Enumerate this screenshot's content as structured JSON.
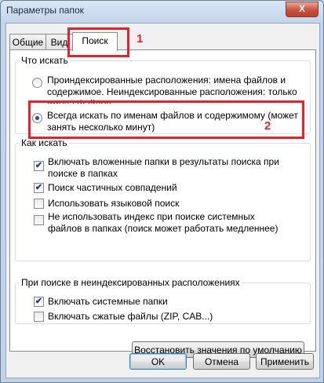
{
  "window": {
    "title": "Параметры папок",
    "close_glyph": "X"
  },
  "tabs": [
    {
      "label": "Общие"
    },
    {
      "label": "Вид"
    },
    {
      "label": "Поиск"
    }
  ],
  "what_to_search": {
    "legend": "Что искать",
    "options": [
      {
        "line1": "Проиндексированные расположения: имена файлов и",
        "line2": "содержимое. Неиндексированные расположения: только",
        "line3": "имена файлов",
        "selected": false
      },
      {
        "line1": "Всегда искать по именам файлов и содержимому (может",
        "line2": "занять несколько минут)",
        "selected": true
      }
    ]
  },
  "how_to_search": {
    "legend": "Как искать",
    "options": [
      {
        "line1": "Включать вложенные папки в результаты поиска при",
        "line2": "поиске в папках",
        "checked": true
      },
      {
        "line1": "Поиск частичных совпадений",
        "checked": true
      },
      {
        "line1": "Использовать языковой поиск",
        "checked": false
      },
      {
        "line1": "Не использовать индекс при поиске системных",
        "line2": "файлов в папках (поиск может работать медленнее)",
        "checked": false
      }
    ]
  },
  "unindexed": {
    "legend": "При поиске в неиндексированных расположениях",
    "options": [
      {
        "line1": "Включать системные папки",
        "checked": true
      },
      {
        "line1": "Включать сжатые файлы (ZIP, CAB...)",
        "checked": false
      }
    ]
  },
  "buttons": {
    "restore_defaults": "Восстановить значения по умолчанию",
    "ok": "OK",
    "cancel": "Отмена",
    "apply": "Применить"
  },
  "annotations": [
    {
      "number": "1"
    },
    {
      "number": "2"
    }
  ],
  "colors": {
    "annotation": "#e8222c",
    "window_frame": "#c2d4ea",
    "check_mark": "#233e6d"
  },
  "check_glyph": "✔"
}
